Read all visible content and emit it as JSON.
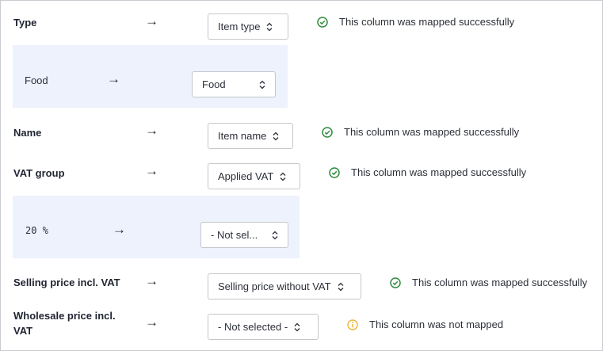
{
  "rows": [
    {
      "field": "Type",
      "selected": "Item type",
      "status": "This column was mapped successfully",
      "status_type": "success",
      "sub": {
        "value": "Food",
        "selected": "Food"
      }
    },
    {
      "field": "Name",
      "selected": "Item name",
      "status": "This column was mapped successfully",
      "status_type": "success"
    },
    {
      "field": "VAT group",
      "selected": "Applied VAT",
      "status": "This column was mapped successfully",
      "status_type": "success",
      "sub": {
        "value": "20 %",
        "selected": "- Not sel..."
      }
    },
    {
      "field": "Selling price incl. VAT",
      "selected": "Selling price without VAT",
      "status": "This column was mapped successfully",
      "status_type": "success"
    },
    {
      "field_line1": "Wholesale price incl.",
      "field_line2": "VAT",
      "selected": "- Not selected -",
      "status": "This column was not mapped",
      "status_type": "warning"
    }
  ],
  "arrow_glyph": "→",
  "icons": {
    "success": "check-circle-icon",
    "warning": "info-circle-icon",
    "select": "chevron-up-down-icon"
  },
  "colors": {
    "success": "#2e8b3e",
    "warning": "#f0b43a",
    "subpanel": "#edf2fd"
  }
}
